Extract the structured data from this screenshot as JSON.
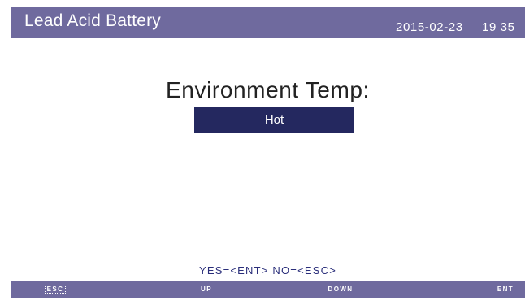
{
  "header": {
    "title": "Lead Acid Battery",
    "date": "2015-02-23",
    "time": "19 35"
  },
  "setting": {
    "label": "Environment Temp:",
    "value": "Hot"
  },
  "prompt": "YES=<ENT>  NO=<ESC>",
  "keys": {
    "esc": "ESC",
    "up": "UP",
    "down": "DOWN",
    "ent": "ENT"
  },
  "colors": {
    "bar": "#6f6a9e",
    "highlight": "#24285f",
    "prompt_text": "#2a2e7a"
  }
}
